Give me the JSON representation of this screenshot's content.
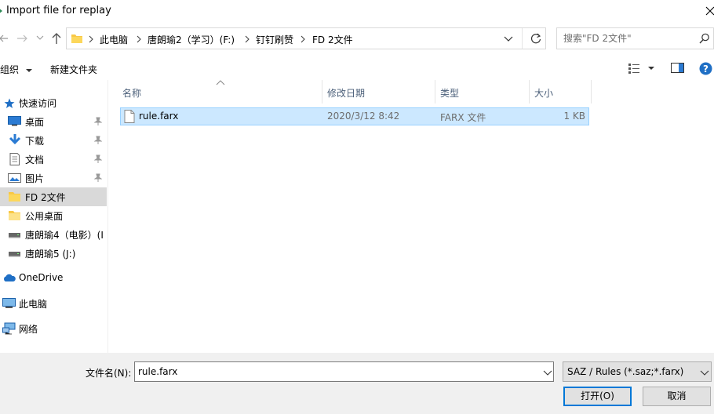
{
  "window": {
    "title": "Import file for replay"
  },
  "address": {
    "crumbs": [
      "此电脑",
      "唐朗瑜2（学习）(F:)",
      "钉钉刷赞",
      "FD 2文件"
    ]
  },
  "search": {
    "placeholder": "搜索\"FD 2文件\""
  },
  "toolbar": {
    "organize_label": "组织",
    "new_folder_label": "新建文件夹"
  },
  "nav": {
    "quick_access": "快速访问",
    "items": [
      {
        "label": "桌面",
        "icon": "desktop-icon",
        "pinned": true
      },
      {
        "label": "下载",
        "icon": "download-icon",
        "pinned": true
      },
      {
        "label": "文档",
        "icon": "document-icon",
        "pinned": true
      },
      {
        "label": "图片",
        "icon": "picture-icon",
        "pinned": true
      },
      {
        "label": "FD 2文件",
        "icon": "folder-icon",
        "pinned": false
      },
      {
        "label": "公用桌面",
        "icon": "folder-icon",
        "pinned": false
      },
      {
        "label": "唐朗瑜4（电影）(I",
        "icon": "drive-icon",
        "pinned": false
      },
      {
        "label": "唐朗瑜5 (J:)",
        "icon": "drive-icon",
        "pinned": false
      }
    ],
    "onedrive": "OneDrive",
    "this_pc": "此电脑",
    "network": "网络"
  },
  "filelist": {
    "columns": [
      "名称",
      "修改日期",
      "类型",
      "大小"
    ],
    "rows": [
      {
        "name": "rule.farx",
        "modified": "2020/3/12 8:42",
        "type": "FARX 文件",
        "size": "1 KB"
      }
    ]
  },
  "footer": {
    "filename_label": "文件名(N):",
    "filename_value": "rule.farx",
    "filter_value": "SAZ / Rules (*.saz;*.farx)",
    "open_label": "打开(O)",
    "cancel_label": "取消"
  },
  "colors": {
    "selection_bg": "#cce8ff",
    "selection_border": "#99d1ff",
    "accent": "#0078d7",
    "folder": "#f8c846"
  }
}
